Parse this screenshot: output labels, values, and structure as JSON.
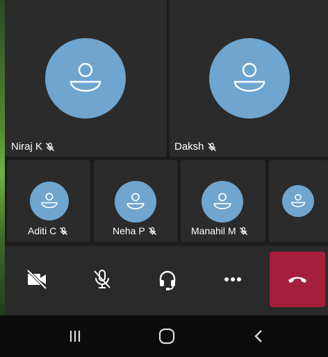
{
  "participants_large": [
    {
      "name": "Niraj K",
      "muted": true
    },
    {
      "name": "Daksh",
      "muted": true
    }
  ],
  "participants_small": [
    {
      "name": "Aditi C",
      "muted": true
    },
    {
      "name": "Neha P",
      "muted": true
    },
    {
      "name": "Manahil M",
      "muted": true
    },
    {
      "name": "",
      "muted": false
    }
  ],
  "controls": {
    "video": "video-off-icon",
    "mic": "mic-off-icon",
    "audio": "headset-icon",
    "more": "more-icon",
    "end_call": "hang-up-icon"
  },
  "colors": {
    "avatar": "#6fa5cf",
    "end_call": "#a51f3c",
    "tile": "#2b2b2b",
    "control_bar": "#2a2a2a"
  },
  "navbar": {
    "recents": "recents-icon",
    "home": "home-icon",
    "back": "back-icon"
  }
}
